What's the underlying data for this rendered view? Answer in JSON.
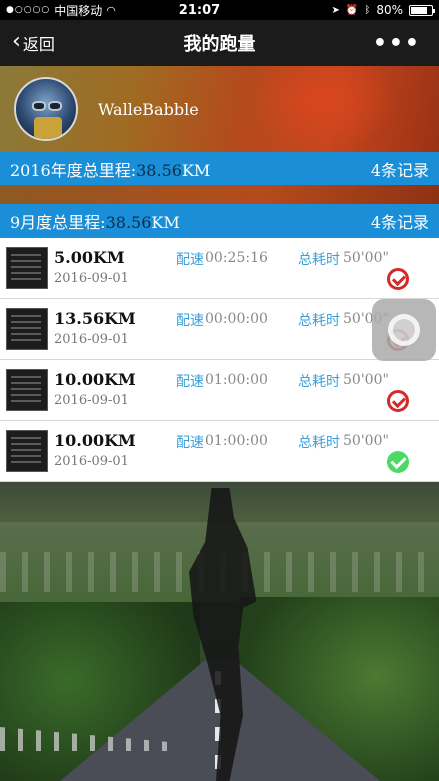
{
  "status_bar": {
    "signal": "●○○○○",
    "carrier": "中国移动",
    "wifi_icon": "wifi-icon",
    "time": "21:07",
    "battery": "80%",
    "battery_level": 0.8
  },
  "nav": {
    "back_label": "返回",
    "title": "我的跑量",
    "more_label": "•••"
  },
  "profile": {
    "username": "WalleBabble"
  },
  "year_summary": {
    "label": "2016年度总里程:",
    "value": "38.56",
    "unit": "KM",
    "count": "4条记录"
  },
  "month_summary": {
    "label": "9月度总里程:",
    "value": "38.56",
    "unit": "KM",
    "count": "4条记录"
  },
  "labels": {
    "pace": "配速",
    "total_time": "总耗时"
  },
  "records": [
    {
      "distance": "5.00KM",
      "date": "2016-09-01",
      "pace": "00:25:16",
      "total_time": "50'00\"",
      "status": "pending"
    },
    {
      "distance": "13.56KM",
      "date": "2016-09-01",
      "pace": "00:00:00",
      "total_time": "50'00\"",
      "status": "pending"
    },
    {
      "distance": "10.00KM",
      "date": "2016-09-01",
      "pace": "01:00:00",
      "total_time": "50'00\"",
      "status": "pending"
    },
    {
      "distance": "10.00KM",
      "date": "2016-09-01",
      "pace": "01:00:00",
      "total_time": "50'00\"",
      "status": "done"
    }
  ]
}
